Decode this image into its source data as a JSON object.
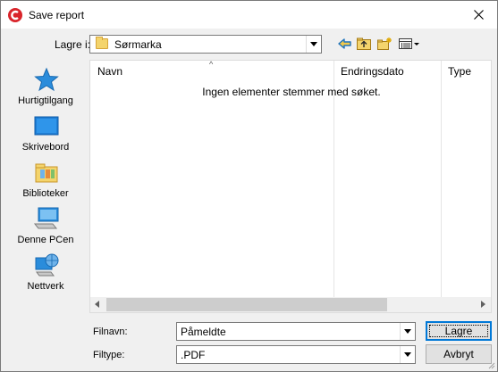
{
  "window": {
    "title": "Save report"
  },
  "toolbar": {
    "lookin_label": "Lagre i:",
    "lookin_value": "Sørmarka",
    "icons": [
      "back-icon",
      "up-folder-icon",
      "new-folder-icon",
      "view-menu-icon"
    ]
  },
  "places": [
    {
      "label": "Hurtigtilgang",
      "icon": "star-icon"
    },
    {
      "label": "Skrivebord",
      "icon": "desktop-icon"
    },
    {
      "label": "Biblioteker",
      "icon": "libraries-icon"
    },
    {
      "label": "Denne PCen",
      "icon": "computer-icon"
    },
    {
      "label": "Nettverk",
      "icon": "network-icon"
    }
  ],
  "filelist": {
    "columns": [
      "Navn",
      "Endringsdato",
      "Type"
    ],
    "empty_message": "Ingen elementer stemmer med søket."
  },
  "form": {
    "filename_label": "Filnavn:",
    "filename_value": "Påmeldte",
    "filetype_label": "Filtype:",
    "filetype_value": ".PDF",
    "save_button": "Lagre",
    "cancel_button": "Avbryt"
  },
  "colors": {
    "accent": "#0078d7",
    "app_icon": "#d9252b"
  }
}
